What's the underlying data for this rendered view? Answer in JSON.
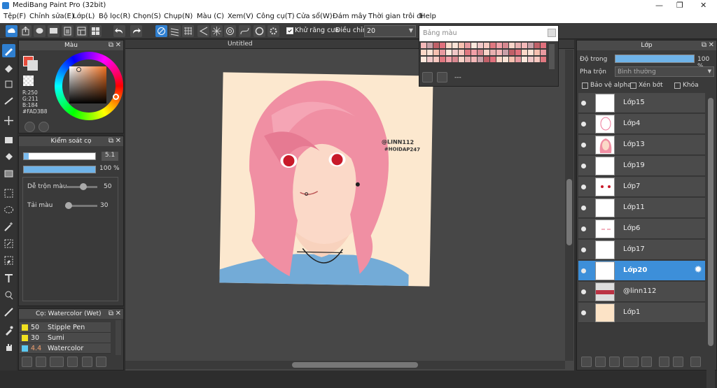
{
  "window": {
    "title": "MediBang Paint Pro (32bit)"
  },
  "menu": [
    "Tệp(F)",
    "Chỉnh sửa(E)",
    "Lớp(L)",
    "Bộ lọc(R)",
    "Chọn(S)",
    "Chụp(N)",
    "Màu (C)",
    "Xem(V)",
    "Công cụ(T)",
    "Cửa sổ(W)",
    "Đám mây",
    "Thời gian trôi đi",
    "Help"
  ],
  "toolbar": {
    "antialias_label": "Khử răng cưa",
    "adjust_label": "Điều chỉnh",
    "adjust_value": "20"
  },
  "palette_popup": {
    "title": "Bảng màu",
    "footer": "---"
  },
  "color_panel": {
    "title": "Màu",
    "r": "R:250",
    "g": "G:211",
    "b": "B:184",
    "hex": "#FAD3B8",
    "fg_color": "#FAD3B8"
  },
  "brush_control": {
    "title": "Kiểm soát cọ",
    "size_value": "5.1",
    "opacity_value": "100 %",
    "blend_label": "Dễ trộn màu",
    "blend_value": "50",
    "color_amount_label": "Tải màu",
    "color_amount_value": "30"
  },
  "brush_list": {
    "title": "Cọ: Watercolor (Wet)",
    "items": [
      {
        "size": "50",
        "name": "Stipple Pen",
        "color": "#f0e020"
      },
      {
        "size": "30",
        "name": "Sumi",
        "color": "#f0e020"
      },
      {
        "size": "4.4",
        "name": "Watercolor",
        "color": "#5cc8f0"
      }
    ]
  },
  "canvas": {
    "tab_title": "Untitled",
    "watermark_line1": "@LINN112",
    "watermark_line2": "#HOIDAP247"
  },
  "layer_panel": {
    "title": "Lớp",
    "opacity_label": "Độ trong",
    "opacity_value": "100 %",
    "blend_label": "Pha trộn",
    "blend_value": "Bình thường",
    "protect_alpha": "Bảo vệ alpha",
    "clipping": "Xén bớt",
    "lock": "Khóa",
    "layers": [
      "Lớp15",
      "Lớp4",
      "Lớp13",
      "Lớp19",
      "Lớp7",
      "Lớp11",
      "Lớp6",
      "Lớp17",
      "Lớp20",
      "@linn112",
      "Lớp1"
    ],
    "selected_layer": "Lớp20"
  }
}
